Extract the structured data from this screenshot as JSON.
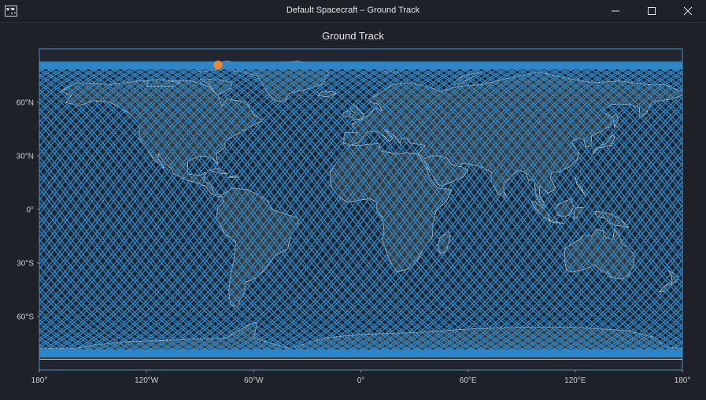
{
  "window": {
    "title": "Default Spacecraft – Ground Track",
    "app_icon": "world-map-icon",
    "controls": [
      "minimize-icon",
      "maximize-icon",
      "close-icon"
    ]
  },
  "colors": {
    "background": "#1e2128",
    "ocean": "#222630",
    "land": "#3b3b3b",
    "coastline": "#d9d9d9",
    "track": "#2f86c6",
    "spacecraft_marker": "#f0872e",
    "plot_border": "#4a90d0"
  },
  "chart_data": {
    "type": "scatter",
    "title": "Ground Track",
    "x_ticks": [
      "180°",
      "120°W",
      "60°W",
      "0°",
      "60°E",
      "120°E",
      "180°"
    ],
    "y_ticks": [
      "60°N",
      "30°N",
      "0°",
      "30°S",
      "60°S"
    ],
    "xlim": [
      -180,
      180
    ],
    "ylim": [
      -90,
      90
    ],
    "projection": "equirectangular",
    "ground_track": {
      "inclination_deg": 82,
      "passes_shown": 60,
      "lon_range": [
        -180,
        180
      ]
    },
    "spacecraft_position": {
      "lon": -80,
      "lat": 81
    }
  }
}
